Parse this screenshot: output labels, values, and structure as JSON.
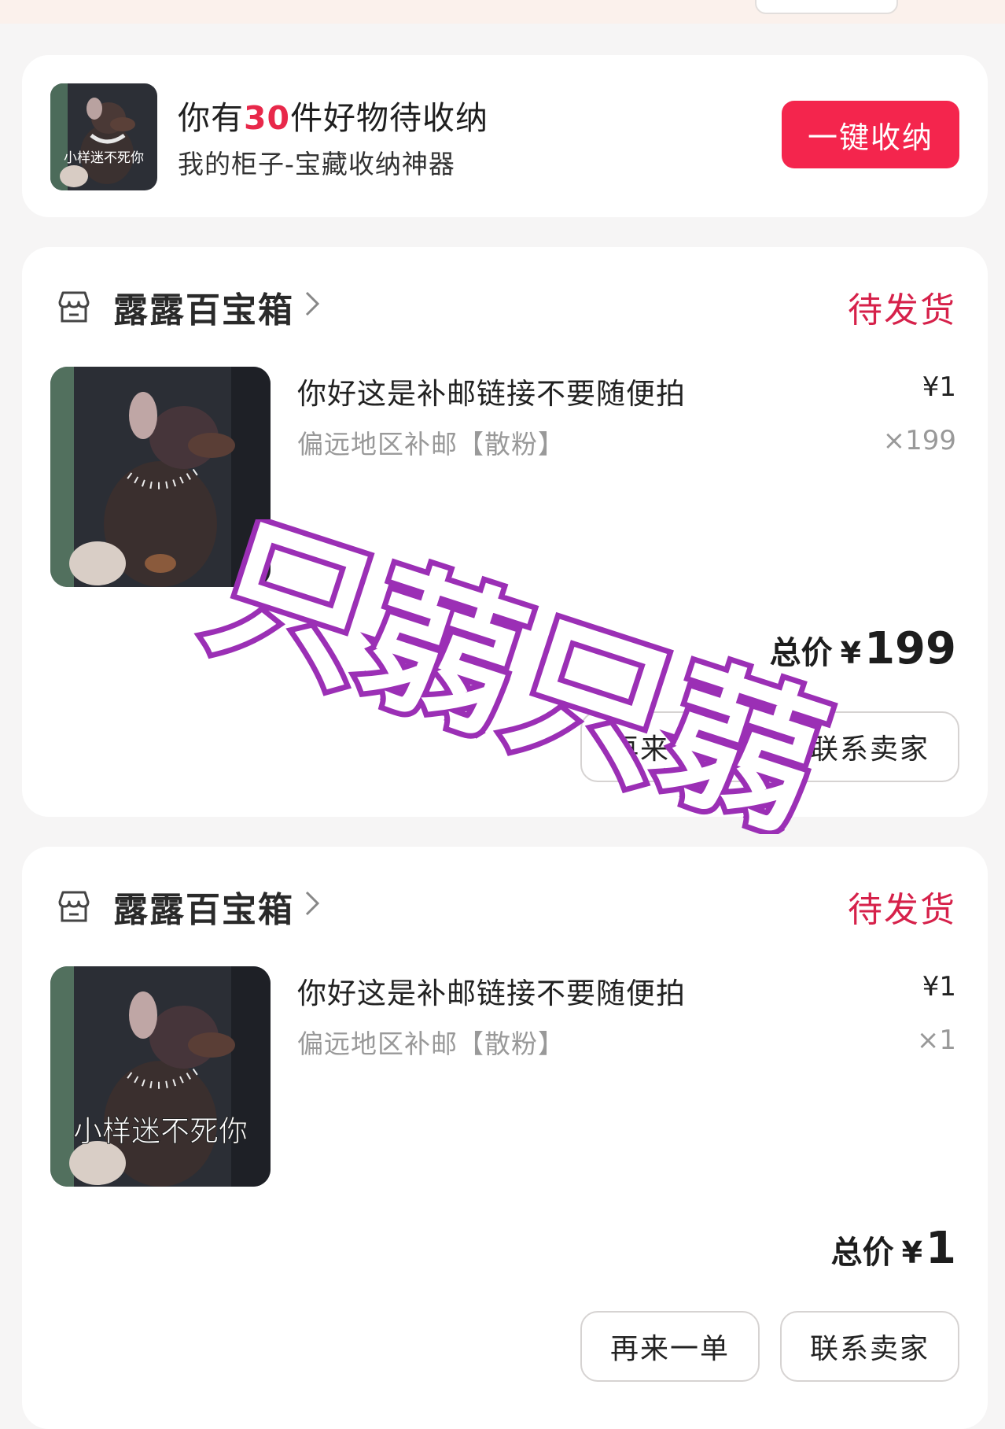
{
  "promo": {
    "title_prefix": "你有",
    "count": "30",
    "title_suffix": "件好物待收纳",
    "subtitle": "我的柜子-宝藏收纳神器",
    "thumb_caption": "小样迷不死你",
    "button_label": "一键收纳",
    "accent_color": "#f4254d"
  },
  "orders": [
    {
      "shop_name": "露露百宝箱",
      "status": "待发货",
      "item_title": "你好这是补邮链接不要随便拍",
      "item_spec": "偏远地区补邮【散粉】",
      "unit_price": "¥1",
      "quantity": "×199",
      "total_label": "总价",
      "currency": "¥",
      "total_value": "199",
      "buttons": {
        "reorder": "再来一单",
        "contact": "联系卖家"
      }
    },
    {
      "shop_name": "露露百宝箱",
      "status": "待发货",
      "item_title": "你好这是补邮链接不要随便拍",
      "item_spec": "偏远地区补邮【散粉】",
      "image_caption": "小样迷不死你",
      "unit_price": "¥1",
      "quantity": "×1",
      "total_label": "总价",
      "currency": "¥",
      "total_value": "1",
      "buttons": {
        "reorder": "再来一单",
        "contact": "联系卖家"
      }
    }
  ],
  "watermark_text": "只蒻只蒻",
  "colors": {
    "status": "#d6214a",
    "watermark": "#9b2fb5"
  }
}
